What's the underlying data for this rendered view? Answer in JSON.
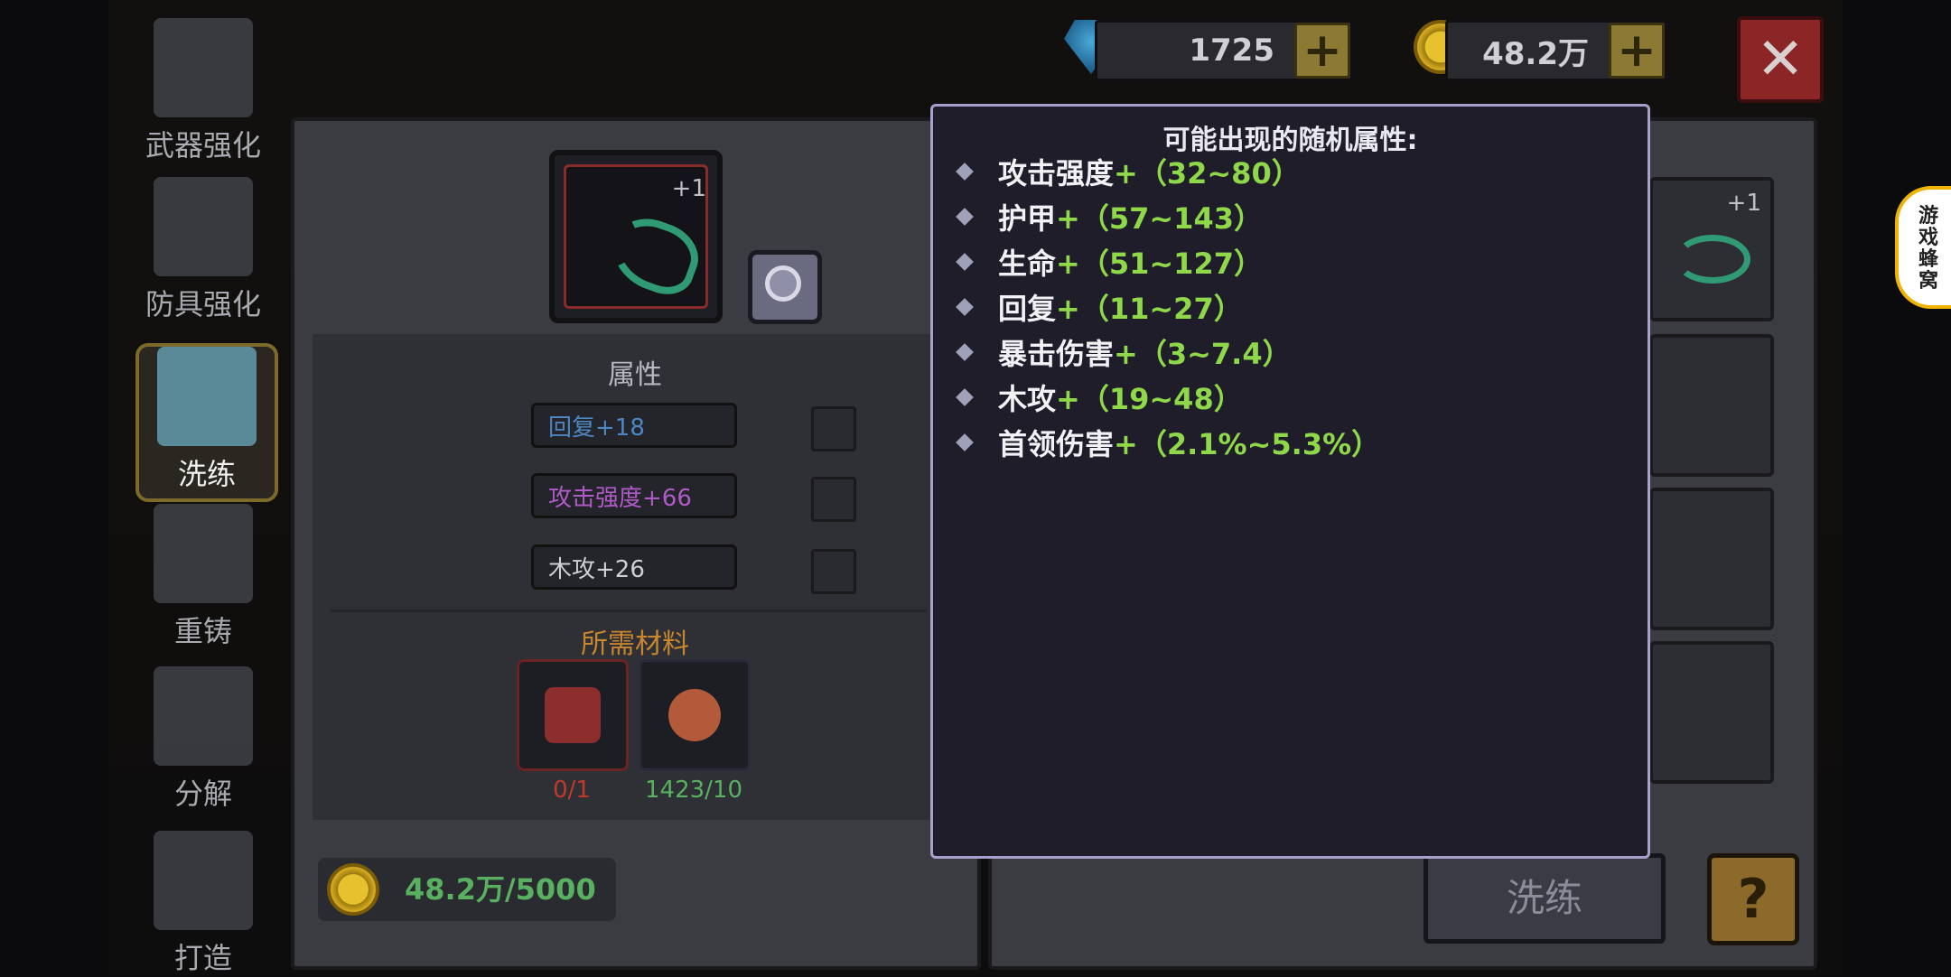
{
  "top_bar": {
    "gems": "1725",
    "gold": "48.2万",
    "gem_icon": "gem-icon",
    "coin_icon": "coin-icon",
    "add_icon": "plus-icon",
    "close_icon": "close-icon"
  },
  "side_nav": [
    {
      "label": "武器强化",
      "icon": "sword-upgrade-icon"
    },
    {
      "label": "防具强化",
      "icon": "armor-upgrade-icon"
    },
    {
      "label": "洗练",
      "icon": "refine-icon",
      "active": true
    },
    {
      "label": "重铸",
      "icon": "reforge-icon"
    },
    {
      "label": "分解",
      "icon": "cauldron-icon"
    },
    {
      "label": "打造",
      "icon": "hammer-icon"
    }
  ],
  "item": {
    "level": "+1",
    "icon": "scythe-weapon-icon"
  },
  "attributes": {
    "title": "属性",
    "list": [
      "回复+18",
      "攻击强度+66",
      "木攻+26"
    ]
  },
  "materials": {
    "title": "所需材料",
    "items": [
      {
        "icon": "scythe-material-icon",
        "count": "0/1",
        "color": "#c0392b"
      },
      {
        "icon": "copper-ore-icon",
        "count": "1423/10",
        "color": "#58b060"
      }
    ]
  },
  "cost": {
    "text": "48.2万/5000"
  },
  "right_panel": {
    "item_level": "+1"
  },
  "actions": {
    "wash_label": "洗练",
    "help_label": "?"
  },
  "tooltip": {
    "title": "可能出现的随机属性:",
    "rows": [
      {
        "name": "攻击强度",
        "range": "+（32~80）"
      },
      {
        "name": "护甲",
        "range": "+（57~143）"
      },
      {
        "name": "生命",
        "range": "+（51~127）"
      },
      {
        "name": "回复",
        "range": "+（11~27）"
      },
      {
        "name": "暴击伤害",
        "range": "+（3~7.4）"
      },
      {
        "name": "木攻",
        "range": "+（19~48）"
      },
      {
        "name": "首领伤害",
        "range": "+（2.1%~5.3%）"
      }
    ]
  },
  "side_ad": {
    "text": "游戏蜂窝"
  }
}
